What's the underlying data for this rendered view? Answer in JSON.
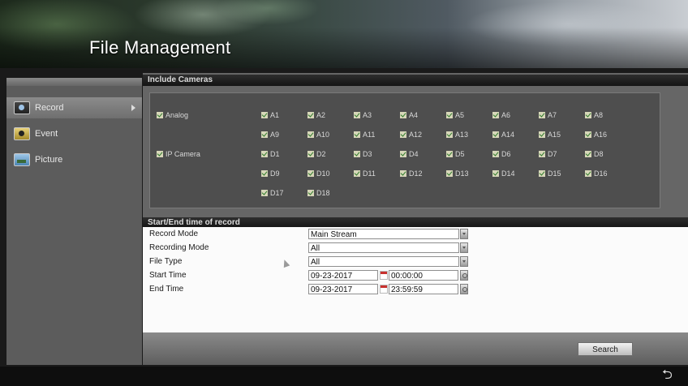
{
  "header": {
    "title": "File Management"
  },
  "sidebar": {
    "items": [
      {
        "label": "Record",
        "icon": "record-icon",
        "active": true
      },
      {
        "label": "Event",
        "icon": "event-icon",
        "active": false
      },
      {
        "label": "Picture",
        "icon": "picture-icon",
        "active": false
      }
    ]
  },
  "include_cameras": {
    "header": "Include Cameras",
    "analog_label": "Analog",
    "ip_camera_label": "IP Camera",
    "analog_row1": [
      "A1",
      "A2",
      "A3",
      "A4",
      "A5",
      "A6",
      "A7",
      "A8"
    ],
    "analog_row2": [
      "A9",
      "A10",
      "A11",
      "A12",
      "A13",
      "A14",
      "A15",
      "A16"
    ],
    "ip_row1": [
      "D1",
      "D2",
      "D3",
      "D4",
      "D5",
      "D6",
      "D7",
      "D8"
    ],
    "ip_row2": [
      "D9",
      "D10",
      "D11",
      "D12",
      "D13",
      "D14",
      "D15",
      "D16"
    ],
    "ip_row3": [
      "D17",
      "D18"
    ]
  },
  "record_time": {
    "header": "Start/End time of record",
    "record_mode_label": "Record Mode",
    "record_mode_value": "Main Stream",
    "recording_mode_label": "Recording Mode",
    "recording_mode_value": "All",
    "file_type_label": "File Type",
    "file_type_value": "All",
    "start_time_label": "Start Time",
    "start_date": "09-23-2017",
    "start_clock": "00:00:00",
    "end_time_label": "End Time",
    "end_date": "09-23-2017",
    "end_clock": "23:59:59"
  },
  "actions": {
    "search_label": "Search"
  },
  "colors": {
    "checkbox_fill": "#d7d7b9",
    "check_mark": "#2e7b2a",
    "calendar_accent": "#c8312e"
  }
}
